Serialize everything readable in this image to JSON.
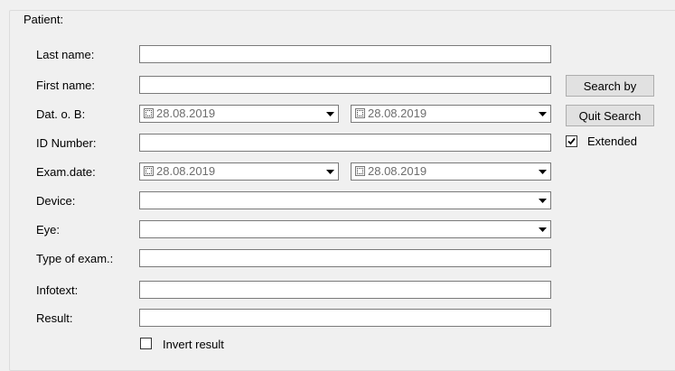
{
  "group": {
    "title": "Patient:"
  },
  "labels": {
    "last_name": "Last name:",
    "first_name": "First name:",
    "dob": "Dat. o. B:",
    "id_number": "ID Number:",
    "exam_date": "Exam.date:",
    "device": "Device:",
    "eye": "Eye:",
    "type_of_exam": "Type of exam.:",
    "infotext": "Infotext:",
    "result": "Result:"
  },
  "fields": {
    "last_name": "",
    "first_name": "",
    "id_number": "",
    "type_of_exam": "",
    "infotext": "",
    "result": "",
    "device": "",
    "eye": ""
  },
  "dates": {
    "dob_from": "28.08.2019",
    "dob_to": "28.08.2019",
    "exam_from": "28.08.2019",
    "exam_to": "28.08.2019"
  },
  "buttons": {
    "search_by": "Search by",
    "quit_search": "Quit Search"
  },
  "checkboxes": {
    "extended": {
      "label": "Extended",
      "checked": true
    },
    "invert_result": {
      "label": "Invert result",
      "checked": false
    }
  }
}
